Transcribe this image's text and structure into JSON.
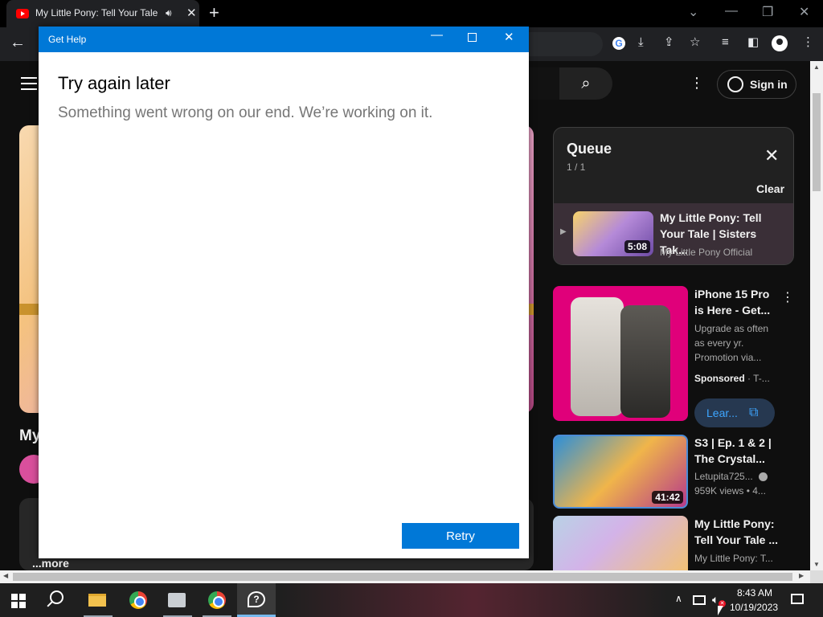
{
  "browser": {
    "tab_title": "My Little Pony: Tell Your Tale",
    "new_tab_label": "+",
    "window_controls": {
      "minimize": "—",
      "restore": "❐",
      "close": "✕"
    }
  },
  "youtube": {
    "sign_in_label": "Sign in",
    "video_title_partial": "My",
    "more_label": "...more",
    "queue": {
      "title": "Queue",
      "position": "1 / 1",
      "clear_label": "Clear",
      "item": {
        "title": "My Little Pony: Tell Your Tale | Sisters Tak...",
        "channel": "My Little Pony Official",
        "duration": "5:08"
      }
    },
    "ad": {
      "title": "iPhone 15 Pro is Here - Get...",
      "description": "Upgrade as often as every yr. Promotion via...",
      "sponsored": "Sponsored",
      "advertiser": "T-...",
      "cta": "Lear..."
    },
    "recommendations": [
      {
        "title": "S3 | Ep. 1 & 2 | The Crystal...",
        "channel": "Letupita725...",
        "meta": "959K views • 4...",
        "duration": "41:42"
      },
      {
        "title": "My Little Pony: Tell Your Tale ...",
        "channel": "My Little Pony: T...",
        "meta": ""
      }
    ]
  },
  "dialog": {
    "window_title": "Get Help",
    "heading": "Try again later",
    "message": "Something went wrong on our end. We’re working on it.",
    "retry_label": "Retry",
    "accent_color": "#0078d7"
  },
  "taskbar": {
    "time": "8:43 AM",
    "date": "10/19/2023",
    "apps": [
      "start-icon",
      "search-icon",
      "file-explorer-icon",
      "chrome-icon",
      "app-icon",
      "chrome-profile-icon",
      "get-help-icon"
    ]
  }
}
